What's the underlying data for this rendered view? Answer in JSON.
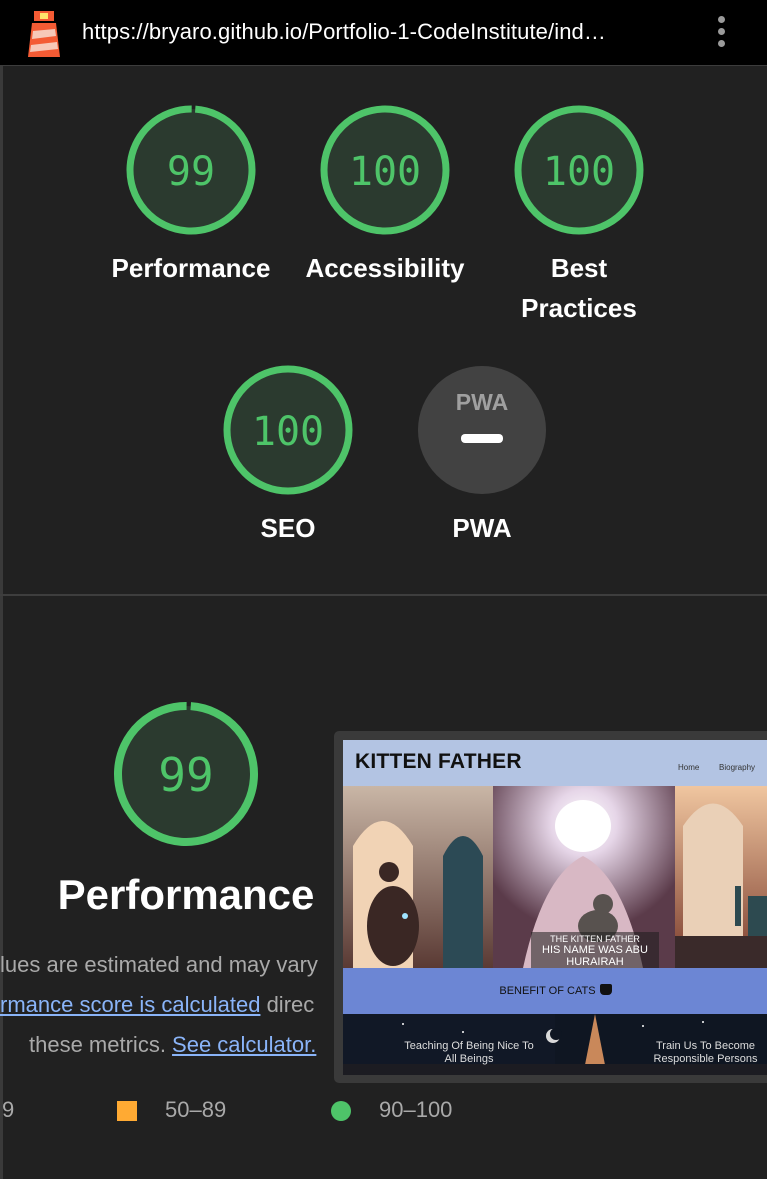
{
  "browser": {
    "url": "https://bryaro.github.io/Portfolio-1-CodeInstitute/ind…",
    "menu_icon": "kebab-menu-icon",
    "logo_icon": "lighthouse-icon"
  },
  "scores": [
    {
      "label": "Performance",
      "value": "99",
      "percent": 99
    },
    {
      "label": "Accessibility",
      "value": "100",
      "percent": 100
    },
    {
      "label": "Best Practices",
      "value": "100",
      "percent": 100
    },
    {
      "label": "SEO",
      "value": "100",
      "percent": 100
    },
    {
      "label": "PWA",
      "value": "",
      "badge": "PWA"
    }
  ],
  "performance": {
    "value": "99",
    "percent": 99,
    "title": "Performance",
    "desc_line1": "lues are estimated and may vary",
    "desc_link1": "rmance score is calculated",
    "desc_line2_rest": " direc",
    "desc_line3_pre": "these metrics. ",
    "desc_link2": "See calculator."
  },
  "legend": {
    "fail_range": "9",
    "average_range": "50–89",
    "pass_range": "90–100"
  },
  "page_screenshot": {
    "brand": "KITTEN FATHER",
    "nav_home": "Home",
    "nav_biography": "Biography",
    "caption_small": "THE KITTEN FATHER",
    "caption_title": "HIS NAME WAS ABU HURAIRAH",
    "band_label": "BENEFIT OF CATS",
    "band_icon": "cat-icon",
    "bottom_left": "Teaching Of Being Nice To All Beings",
    "bottom_right": "Train Us To Become Responsible Persons"
  },
  "colors": {
    "pass": "#4ec469",
    "average": "#ffaa33",
    "link": "#8ab4f8",
    "background": "#212121"
  }
}
